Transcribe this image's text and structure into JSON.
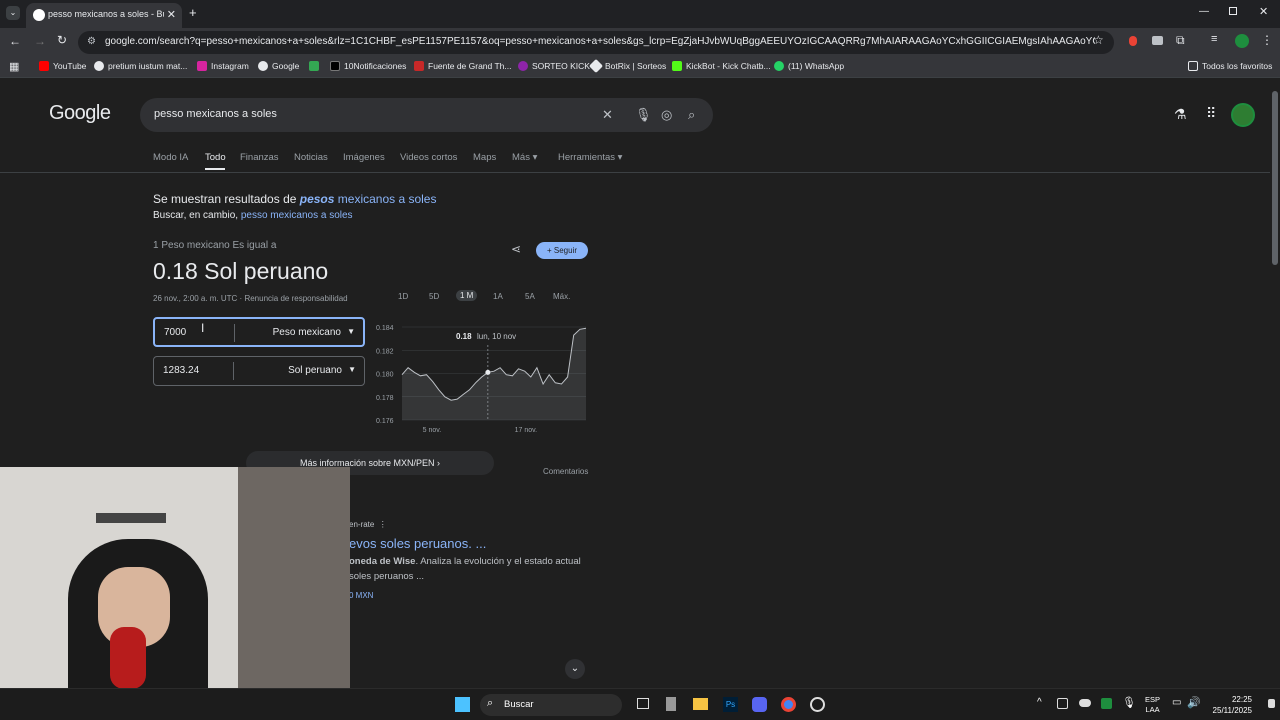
{
  "browser": {
    "tab_title": "pesso mexicanos a soles - Busca",
    "url": "google.com/search?q=pesso+mexicanos+a+soles&rlz=1C1CHBF_esPE1157PE1157&oq=pesso+mexicanos+a+soles&gs_lcrp=EgZjaHJvbWUqBggAEEUYOzIGCAAQRRg7MhAIARAAGAoYCxhGGIICGIAEMgsIAhAAGAoYCxiABDIL CAMQABgK...",
    "bookmarks": [
      "YouTube",
      "pretium iustum mat...",
      "Instagram",
      "Google",
      "10Notificaciones",
      "Fuente de Grand Th...",
      "SORTEO KICK",
      "BotRix | Sorteos",
      "KickBot - Kick Chatb...",
      "(11) WhatsApp"
    ],
    "all_bookmarks": "Todos los favoritos"
  },
  "google": {
    "logo": "Google",
    "query": "pesso mexicanos a soles",
    "tabs": [
      "Modo IA",
      "Todo",
      "Finanzas",
      "Noticias",
      "Imágenes",
      "Videos cortos",
      "Maps",
      "Más",
      "Herramientas"
    ],
    "correction_prefix": "Se muestran resultados de ",
    "correction_em": "pesos",
    "correction_rest": " mexicanos a soles",
    "instead_prefix": "Buscar, en cambio, ",
    "instead_link": "pesso mexicanos a soles"
  },
  "converter": {
    "equals_label": "1 Peso mexicano Es igual a",
    "result": "0.18 Sol peruano",
    "timestamp": "26 nov., 2:00 a. m. UTC · Renuncia de responsabilidad",
    "follow": "Seguir",
    "ranges": [
      "1D",
      "5D",
      "1 M",
      "1A",
      "5A",
      "Máx."
    ],
    "from_value": "7000",
    "from_currency": "Peso mexicano",
    "to_value": "1283.24",
    "to_currency": "Sol peruano",
    "more_info": "Más información sobre MXN/PEN",
    "comments": "Comentarios"
  },
  "chart_data": {
    "type": "line",
    "y_ticks": [
      "0.184",
      "0.182",
      "0.180",
      "0.178",
      "0.176"
    ],
    "x_ticks": [
      "5 nov.",
      "17 nov."
    ],
    "tooltip_value": "0.18",
    "tooltip_date": "lun, 10 nov",
    "ylim": [
      0.176,
      0.184
    ],
    "values": [
      0.1799,
      0.1805,
      0.1801,
      0.1798,
      0.1799,
      0.1793,
      0.1786,
      0.178,
      0.1777,
      0.1778,
      0.1782,
      0.1786,
      0.1792,
      0.1797,
      0.1801,
      0.1802,
      0.1805,
      0.1799,
      0.1798,
      0.1804,
      0.1802,
      0.1797,
      0.1805,
      0.1791,
      0.1799,
      0.1792,
      0.1791,
      0.1797,
      0.1833,
      0.1838,
      0.1839
    ]
  },
  "results": {
    "site_suffix": "en-rate",
    "link_title": "evos soles peruanos. ...",
    "snippet_line1_bold": "oneda de Wise",
    "snippet_line1_rest": ". Analiza la evolución y el estado actual",
    "snippet_line2": "soles peruanos ...",
    "chip": "0 MXN"
  },
  "taskbar": {
    "search": "Buscar",
    "lang": "ESP",
    "lang2": "LAA",
    "time": "22:25",
    "date": "25/11/2025"
  }
}
